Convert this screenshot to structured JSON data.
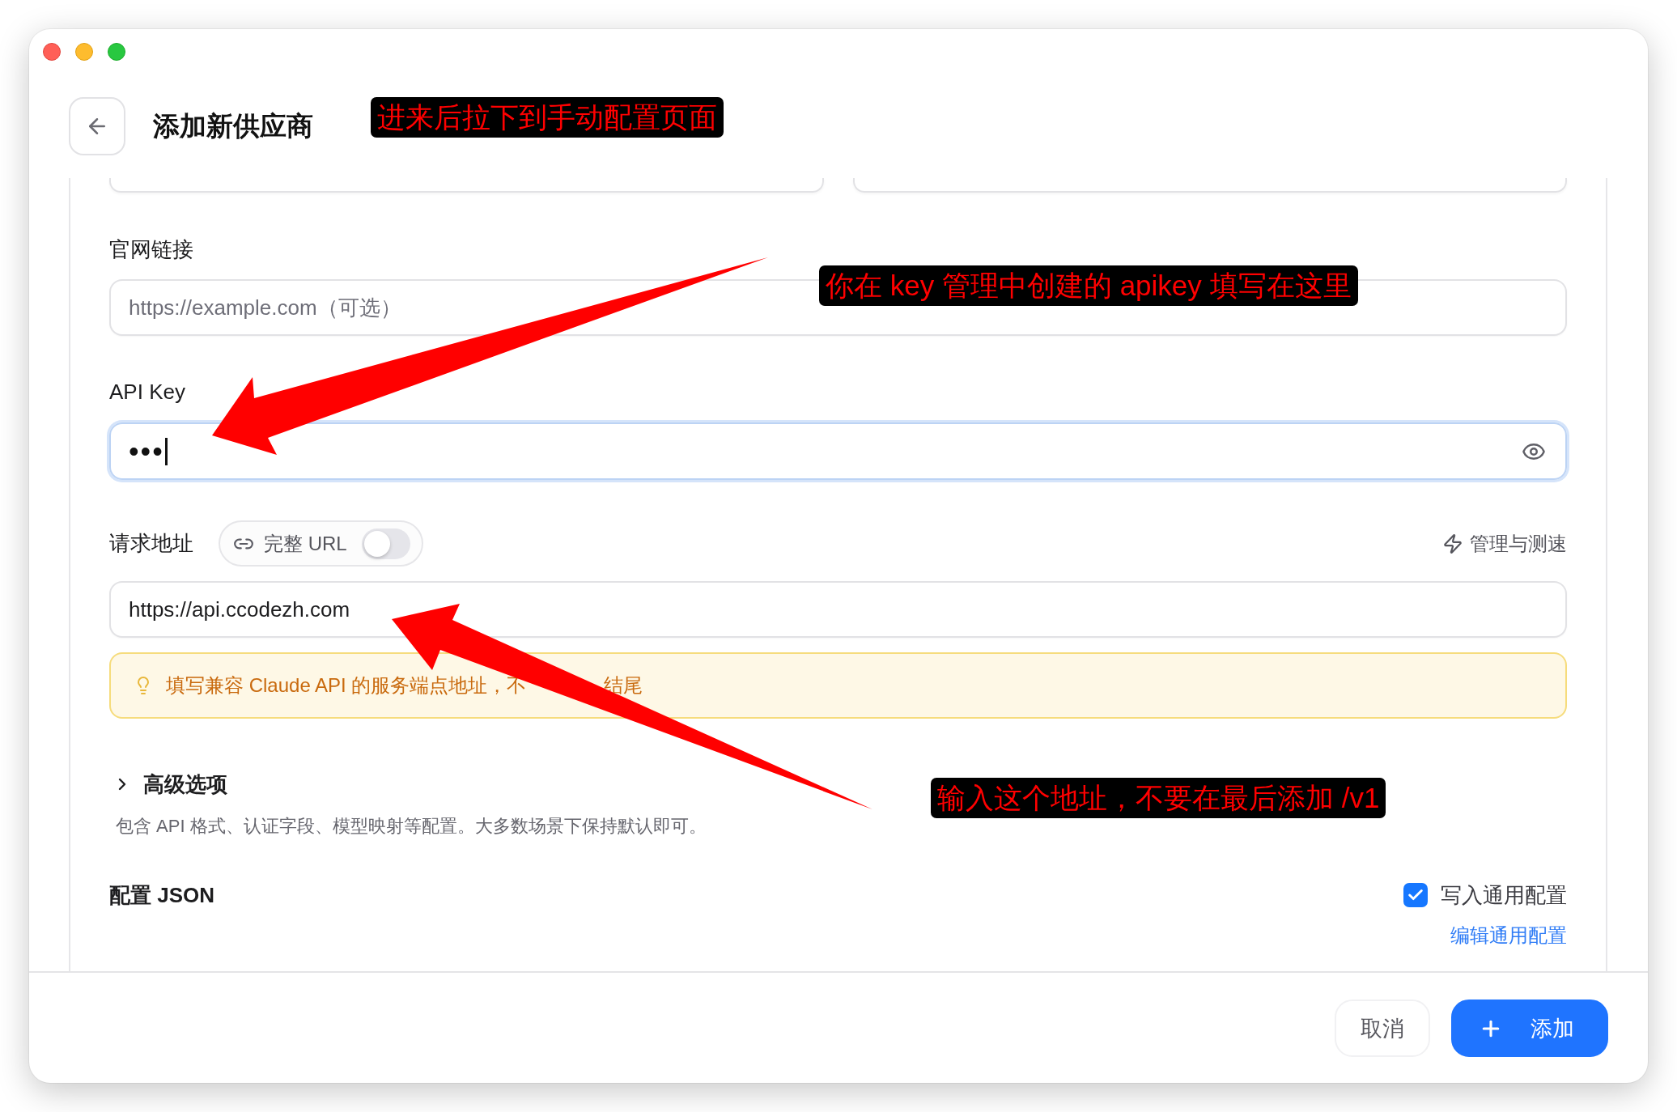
{
  "header": {
    "title": "添加新供应商"
  },
  "form": {
    "website": {
      "label": "官网链接",
      "placeholder": "https://example.com（可选）"
    },
    "api_key": {
      "label": "API Key",
      "value": "•••",
      "focused": true
    },
    "base_url": {
      "label": "请求地址",
      "full_url_toggle": {
        "label": "完整 URL",
        "on": false
      },
      "action": "管理与测速",
      "value": "https://api.ccodezh.com",
      "hint_parts": [
        "填写兼容 Claude API 的服务端点地址，不",
        "结尾"
      ]
    },
    "advanced": {
      "label": "高级选项",
      "expanded": false,
      "description": "包含 API 格式、认证字段、模型映射等配置。大多数场景下保持默认即可。"
    },
    "config_json": {
      "label": "配置 JSON",
      "write_common": {
        "label": "写入通用配置",
        "checked": true
      },
      "edit_link": "编辑通用配置"
    }
  },
  "footer": {
    "buttons": [
      {
        "label": "取消",
        "kind": "secondary"
      },
      {
        "label": "添加",
        "kind": "primary"
      }
    ]
  },
  "annotations": [
    {
      "text": "进来后拉下到手动配置页面"
    },
    {
      "text": "你在 key 管理中创建的 apikey 填写在这里"
    },
    {
      "text": "输入这个地址，不要在最后添加 /v1"
    }
  ]
}
